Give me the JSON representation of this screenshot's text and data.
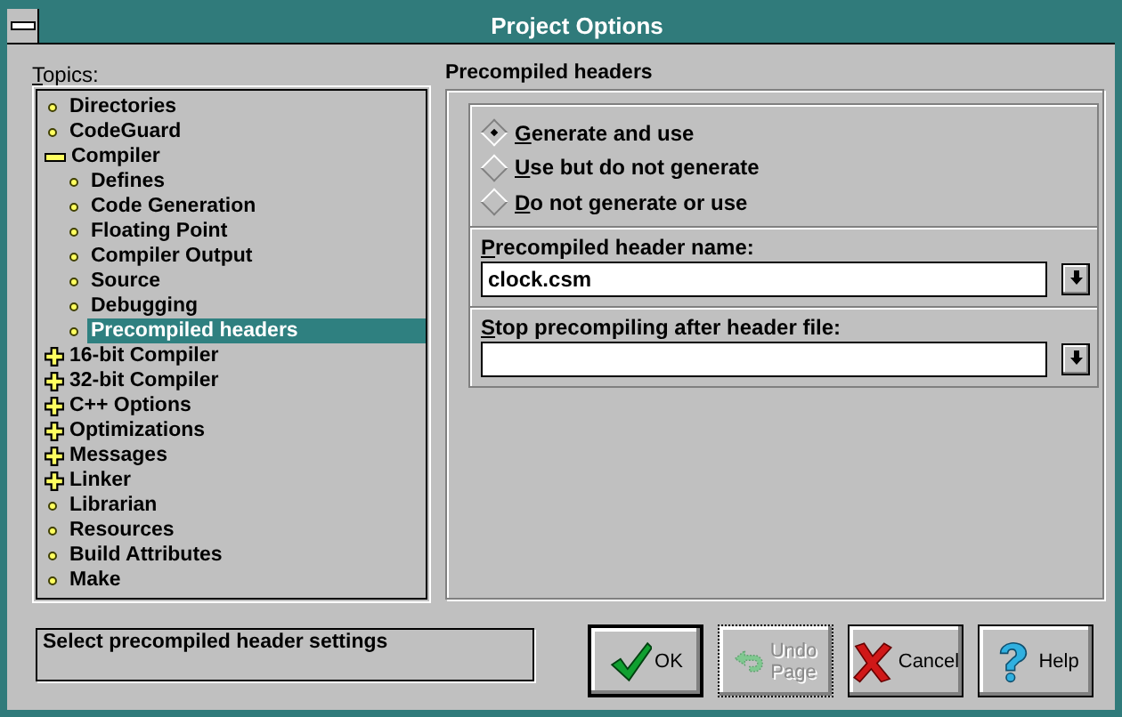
{
  "window": {
    "title": "Project Options"
  },
  "topics": {
    "label": "Topics:",
    "items": [
      {
        "label": "Directories",
        "kind": "leaf",
        "selected": false
      },
      {
        "label": "CodeGuard",
        "kind": "leaf",
        "selected": false
      },
      {
        "label": "Compiler",
        "kind": "folder",
        "expanded": true,
        "selected": false,
        "children": [
          {
            "label": "Defines",
            "kind": "leaf",
            "selected": false
          },
          {
            "label": "Code Generation",
            "kind": "leaf",
            "selected": false
          },
          {
            "label": "Floating Point",
            "kind": "leaf",
            "selected": false
          },
          {
            "label": "Compiler Output",
            "kind": "leaf",
            "selected": false
          },
          {
            "label": "Source",
            "kind": "leaf",
            "selected": false
          },
          {
            "label": "Debugging",
            "kind": "leaf",
            "selected": false
          },
          {
            "label": "Precompiled headers",
            "kind": "leaf",
            "selected": true
          }
        ]
      },
      {
        "label": "16-bit Compiler",
        "kind": "folder",
        "expanded": false,
        "selected": false
      },
      {
        "label": "32-bit Compiler",
        "kind": "folder",
        "expanded": false,
        "selected": false
      },
      {
        "label": "C++ Options",
        "kind": "folder",
        "expanded": false,
        "selected": false
      },
      {
        "label": "Optimizations",
        "kind": "folder",
        "expanded": false,
        "selected": false
      },
      {
        "label": "Messages",
        "kind": "folder",
        "expanded": false,
        "selected": false
      },
      {
        "label": "Linker",
        "kind": "folder",
        "expanded": false,
        "selected": false
      },
      {
        "label": "Librarian",
        "kind": "leaf",
        "selected": false
      },
      {
        "label": "Resources",
        "kind": "leaf",
        "selected": false
      },
      {
        "label": "Build Attributes",
        "kind": "leaf",
        "selected": false
      },
      {
        "label": "Make",
        "kind": "leaf",
        "selected": false
      }
    ]
  },
  "status": "Select precompiled header settings",
  "page": {
    "title": "Precompiled headers",
    "options": [
      {
        "label": "Generate and use",
        "selected": true
      },
      {
        "label": "Use but do not generate",
        "selected": false
      },
      {
        "label": "Do not generate or use",
        "selected": false
      }
    ],
    "fields": [
      {
        "label": "Precompiled header name:",
        "value": "clock.csm"
      },
      {
        "label": "Stop precompiling after header file:"
      }
    ]
  },
  "buttons": [
    {
      "label": "OK",
      "kind": "ok",
      "default": true,
      "disabled": false
    },
    {
      "label": "Undo Page",
      "kind": "undo",
      "default": false,
      "disabled": true
    },
    {
      "label": "Cancel",
      "kind": "cancel",
      "default": false,
      "disabled": false
    },
    {
      "label": "Help",
      "kind": "help",
      "default": false,
      "disabled": false
    }
  ]
}
